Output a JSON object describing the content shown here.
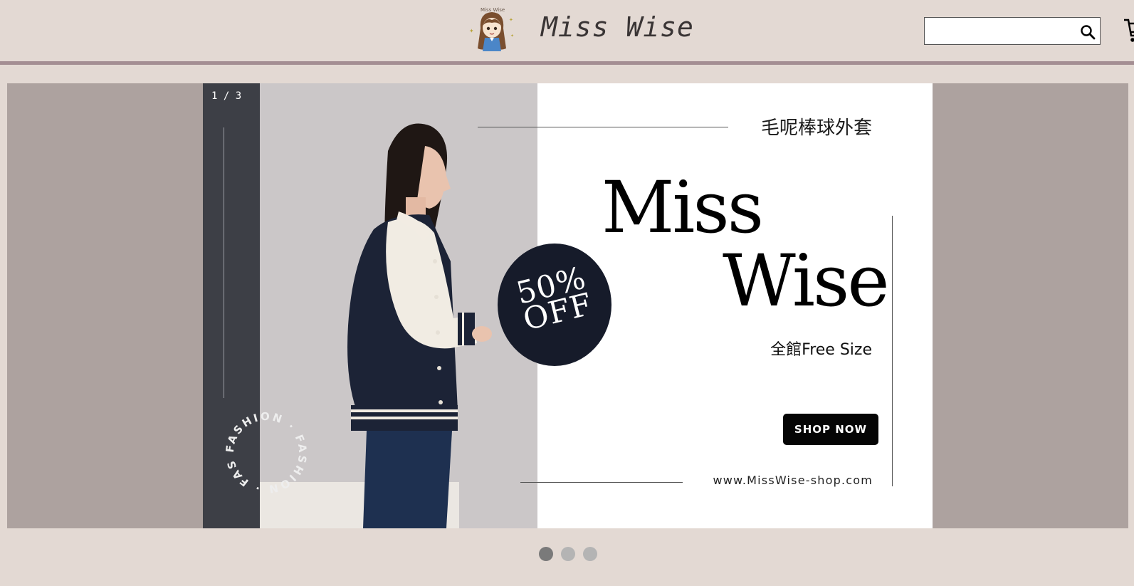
{
  "header": {
    "brand_title": "Miss Wise",
    "logo_tiny_text": "Miss Wise",
    "search": {
      "value": "",
      "placeholder": ""
    },
    "icons": {
      "search": "search-icon",
      "cart": "cart-icon"
    }
  },
  "carousel": {
    "counter": "1 / 3",
    "current_slide": 1,
    "total_slides": 3,
    "slide": {
      "product_name": "毛呢棒球外套",
      "brand_line_1": "Miss",
      "brand_line_2": "Wise",
      "promo_line_1": "50%",
      "promo_line_2": "OFF",
      "size_note": "全館Free Size",
      "cta_label": "SHOP NOW",
      "website": "www.MissWise-shop.com",
      "ring_text": "FASHION · FASHION · FASHION ·"
    }
  },
  "colors": {
    "page_bg": "#e3d9d3",
    "header_rule": "#a48e93",
    "carousel_bg": "#ada29f",
    "strip": "#3d3f46",
    "promo_circle": "#161b2a",
    "cta_bg": "#050505",
    "dot_active": "#7a7a7a",
    "dot_inactive": "#b4b4b4"
  }
}
